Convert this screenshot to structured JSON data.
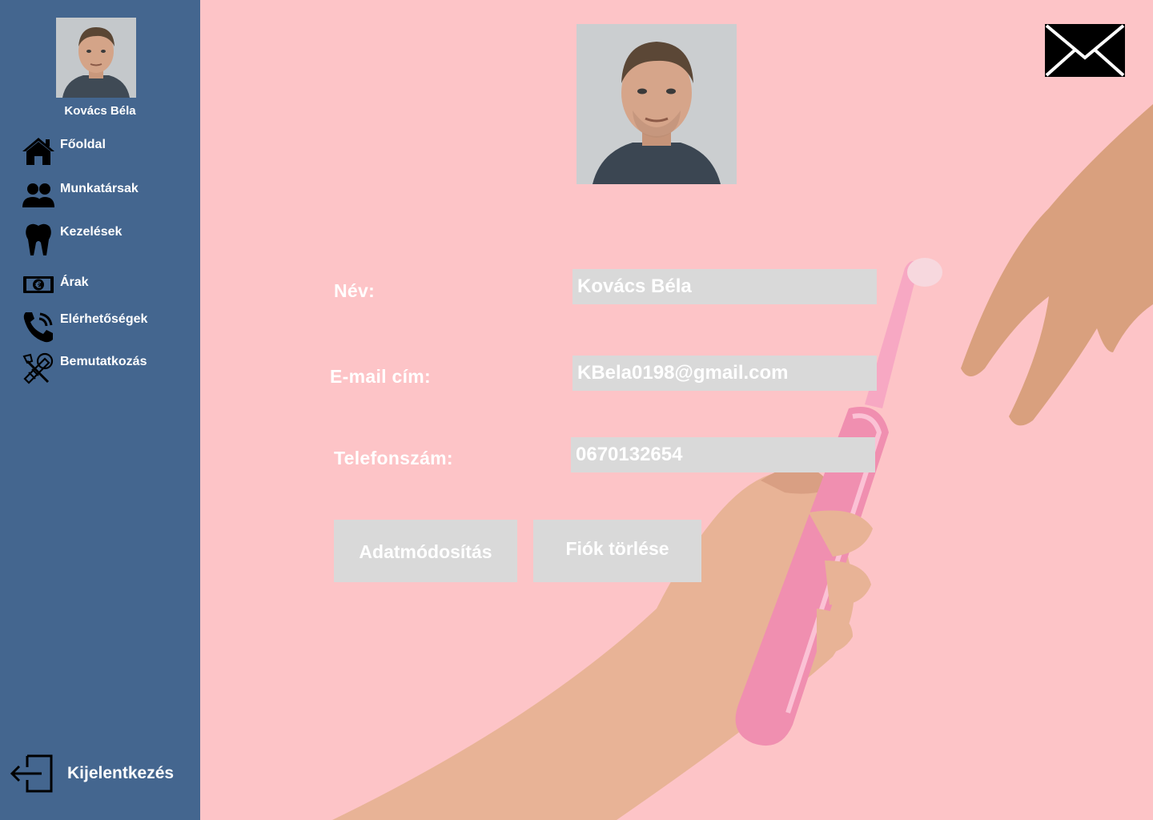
{
  "user": {
    "name": "Kovács Béla"
  },
  "sidebar": {
    "items": [
      {
        "label": "Főoldal",
        "icon": "home-icon"
      },
      {
        "label": "Munkatársak",
        "icon": "people-icon"
      },
      {
        "label": "Kezelések",
        "icon": "tooth-icon"
      },
      {
        "label": "Árak",
        "icon": "euro-banknote-icon"
      },
      {
        "label": "Elérhetőségek",
        "icon": "phone-icon"
      },
      {
        "label": "Bemutatkozás",
        "icon": "tools-icon"
      }
    ],
    "logout_label": "Kijelentkezés"
  },
  "form": {
    "name_label": "Név:",
    "name_value": "Kovács Béla",
    "email_label": "E-mail cím:",
    "email_value": "KBela0198@gmail.com",
    "phone_label": "Telefonszám:",
    "phone_value": "0670132654"
  },
  "actions": {
    "edit_label": "Adatmódosítás",
    "delete_label": "Fiók törlése"
  },
  "colors": {
    "sidebar": "#44668f",
    "background": "#fdc4c7",
    "field": "#d9d9d9"
  }
}
